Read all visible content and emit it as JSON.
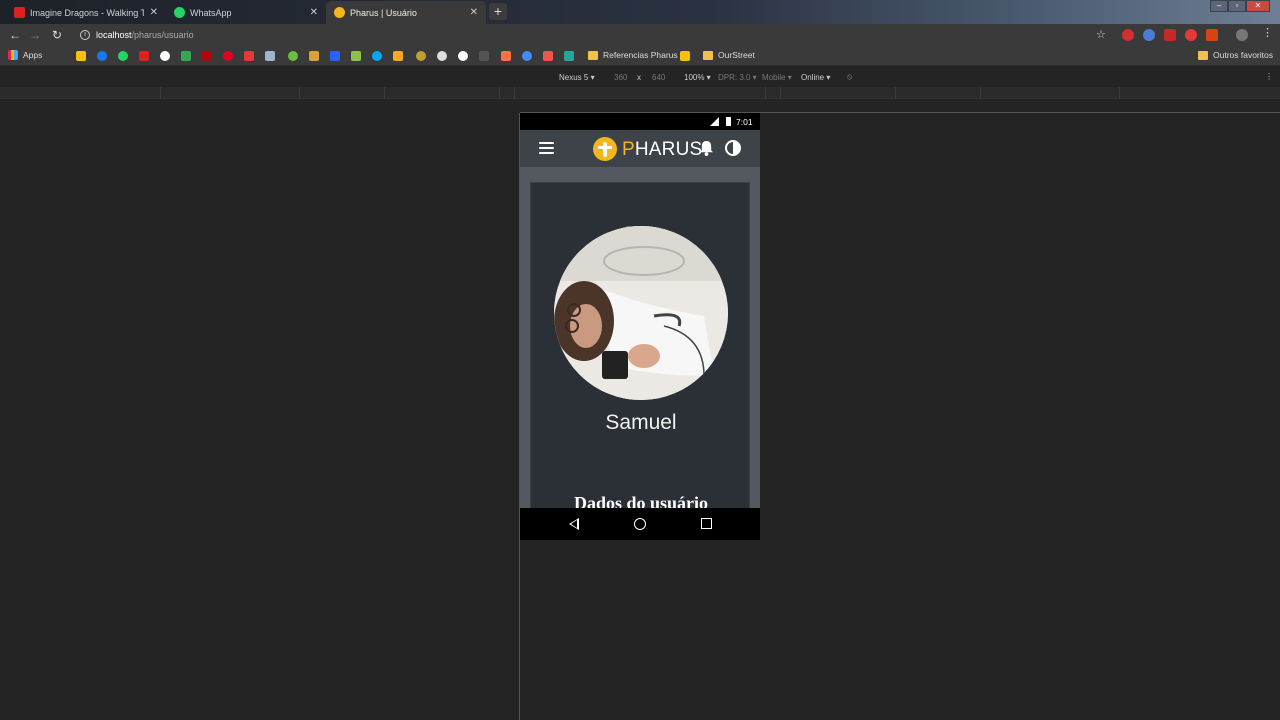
{
  "tabs": [
    {
      "title": "Imagine Dragons - Walking The",
      "icon": "youtube-icon",
      "color": "#e02020"
    },
    {
      "title": "WhatsApp",
      "icon": "whatsapp-icon",
      "color": "#25d366"
    },
    {
      "title": "Pharus | Usuário",
      "icon": "pharus-icon",
      "color": "#f2b71d"
    }
  ],
  "new_tab_label": "+",
  "address": {
    "host": "localhost",
    "path": "/pharus/usuario"
  },
  "bookmarks": {
    "apps_label": "Apps",
    "folder1": "Referencias Pharus",
    "folder2": "OurStreet",
    "other": "Outros favoritos"
  },
  "device_toolbar": {
    "device": "Nexus 5 ▾",
    "width": "360",
    "sep": "x",
    "height": "640",
    "zoom": "100% ▾",
    "dpr": "DPR: 3.0 ▾",
    "mode": "Mobile ▾",
    "network": "Online ▾"
  },
  "phone": {
    "time": "7:01",
    "brand": "PHARUS",
    "brand_initial": "P",
    "brand_rest": "HARUS",
    "username": "Samuel",
    "section_title": "Dados do usuário"
  },
  "colors": {
    "accent": "#f2b71d",
    "appbar": "#3e4249",
    "card": "#2b2f36"
  }
}
